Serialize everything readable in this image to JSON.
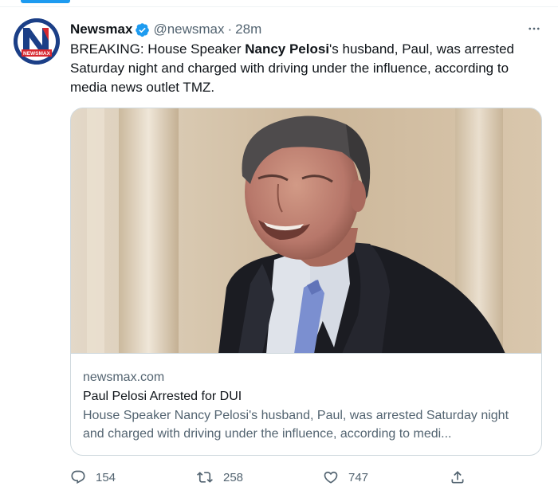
{
  "tweet": {
    "author_name": "Newsmax",
    "handle": "@newsmax",
    "separator": "·",
    "time": "28m",
    "verified": true,
    "avatar_label": "NEWSMAX",
    "text_before": "BREAKING: House Speaker ",
    "text_bold": "Nancy Pelosi",
    "text_after": "'s husband, Paul, was arrested Saturday night and charged with driving under the influence, according to media news outlet TMZ."
  },
  "card": {
    "domain": "newsmax.com",
    "title": "Paul Pelosi Arrested for DUI",
    "description": "House Speaker Nancy Pelosi's husband, Paul, was arrested Saturday night and charged with driving under the influence, according to medi..."
  },
  "actions": {
    "reply_count": "154",
    "retweet_count": "258",
    "like_count": "747"
  },
  "colors": {
    "accent": "#1d9bf0",
    "text_primary": "#0f1419",
    "text_secondary": "#536471",
    "border": "#cfd9de",
    "avatar_bg": "#1b3f87"
  },
  "icons": [
    "more-icon",
    "verified-icon",
    "reply-icon",
    "retweet-icon",
    "like-icon",
    "share-icon"
  ]
}
